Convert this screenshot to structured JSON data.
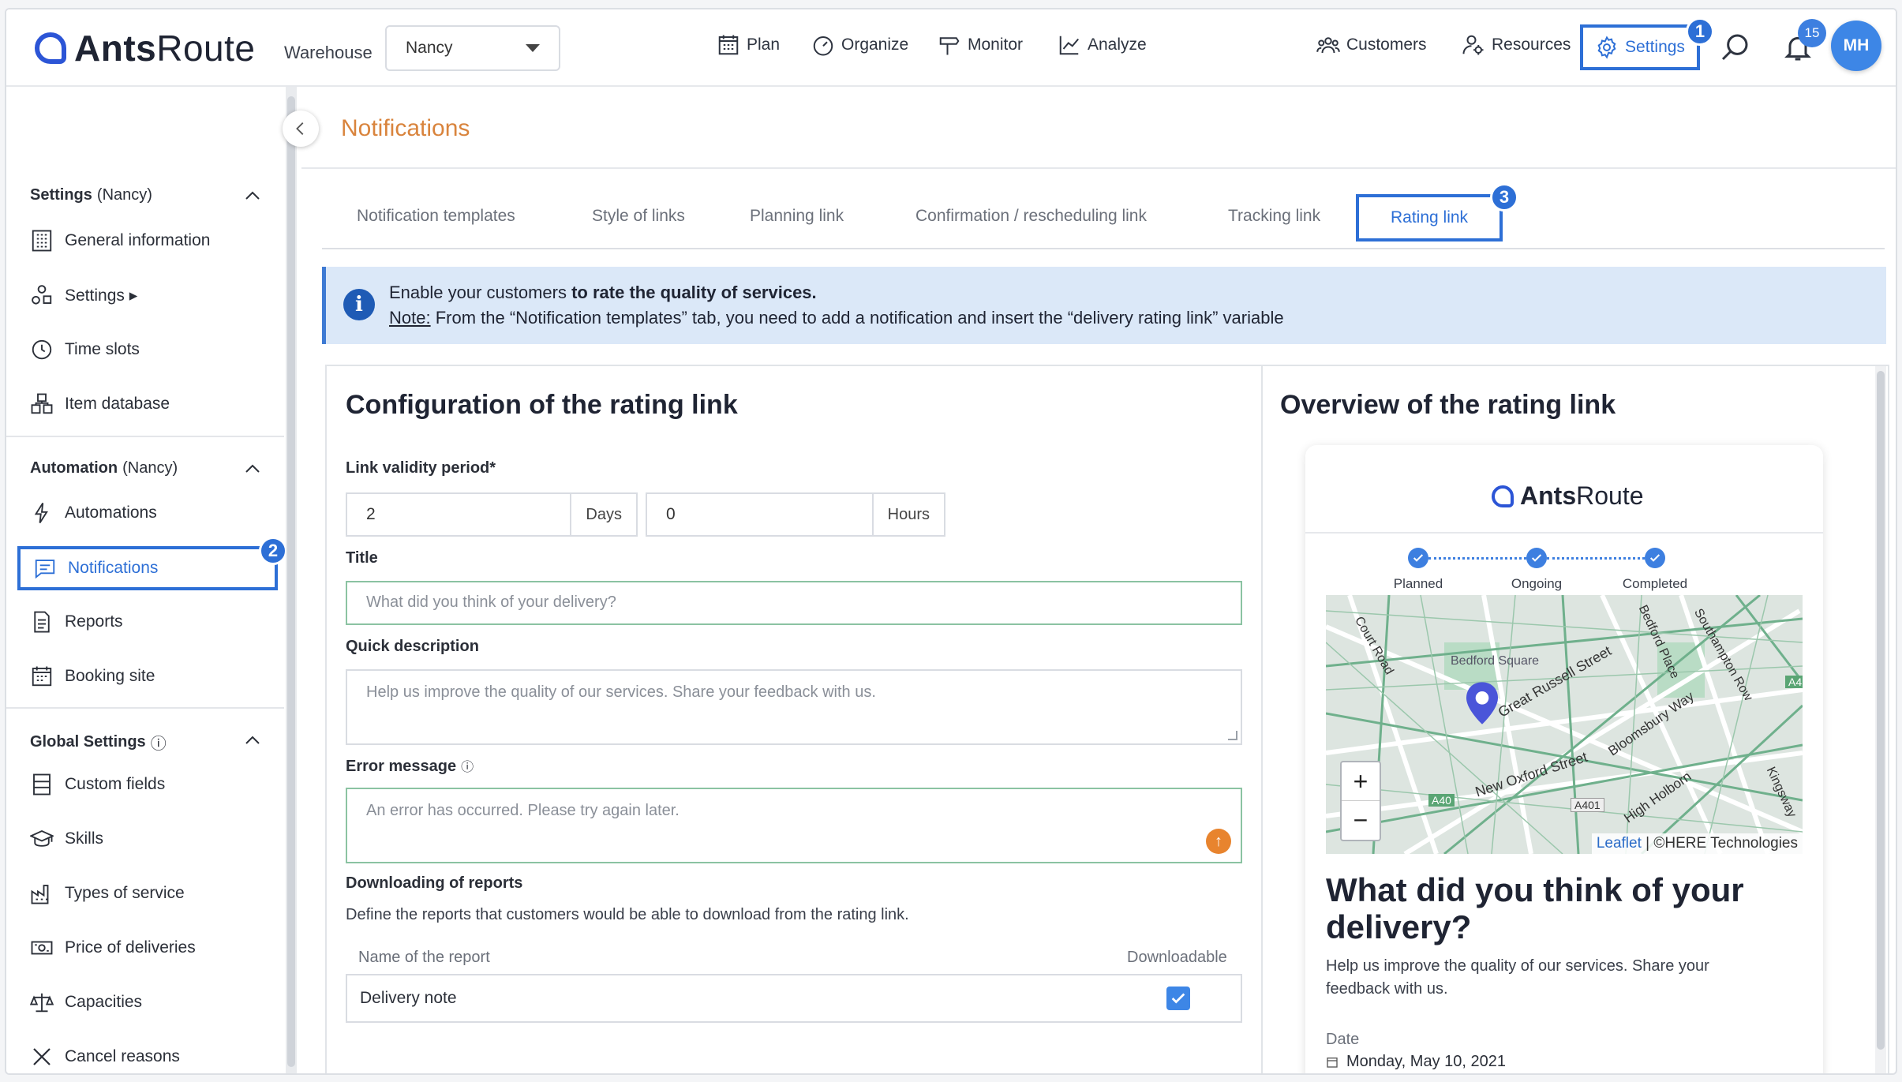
{
  "app": {
    "logo_bold": "Ants",
    "logo_rest": "Route"
  },
  "header": {
    "warehouse_label": "Warehouse",
    "warehouse_value": "Nancy",
    "nav": [
      "Plan",
      "Organize",
      "Monitor",
      "Analyze"
    ],
    "right_nav": [
      "Customers",
      "Resources"
    ],
    "settings_label": "Settings",
    "notification_count": "15",
    "avatar_initials": "MH"
  },
  "annotations": [
    "1",
    "2",
    "3"
  ],
  "sidebar": {
    "sections": [
      {
        "title": "Settings",
        "suffix": "(Nancy)"
      },
      {
        "title": "Automation",
        "suffix": "(Nancy)"
      },
      {
        "title": "Global Settings",
        "suffix": "ⓘ"
      }
    ],
    "items": [
      {
        "label": "General information",
        "icon": "building-icon"
      },
      {
        "label": "Settings ▸",
        "icon": "settings-shapes-icon"
      },
      {
        "label": "Time slots",
        "icon": "clock-icon"
      },
      {
        "label": "Item database",
        "icon": "boxes-icon"
      },
      {
        "label": "Automations",
        "icon": "bolt-icon"
      },
      {
        "label": "Notifications",
        "icon": "chat-icon"
      },
      {
        "label": "Reports",
        "icon": "document-icon"
      },
      {
        "label": "Booking site",
        "icon": "calendar-icon"
      },
      {
        "label": "Custom fields",
        "icon": "list-icon"
      },
      {
        "label": "Skills",
        "icon": "graduation-cap-icon"
      },
      {
        "label": "Types of service",
        "icon": "factory-icon"
      },
      {
        "label": "Price of deliveries",
        "icon": "banknote-icon"
      },
      {
        "label": "Capacities",
        "icon": "scale-icon"
      },
      {
        "label": "Cancel reasons",
        "icon": "x-icon"
      }
    ]
  },
  "page": {
    "title": "Notifications",
    "tabs": [
      "Notification templates",
      "Style of links",
      "Planning link",
      "Confirmation / rescheduling link",
      "Tracking link",
      "Rating link"
    ],
    "info": {
      "line1_prefix": "Enable your customers ",
      "line1_bold": "to rate the quality of services.",
      "note_label": "Note:",
      "line2": " From the “Notification templates” tab, you need to add a notification and insert the “delivery rating link” variable"
    }
  },
  "config": {
    "heading": "Configuration of the rating link",
    "validity_label": "Link validity period*",
    "days_value": "2",
    "days_unit": "Days",
    "hours_value": "0",
    "hours_unit": "Hours",
    "title_label": "Title",
    "title_placeholder": "What did you think of your delivery?",
    "quick_desc_label": "Quick description",
    "quick_desc_placeholder": "Help us improve the quality of our services. Share your feedback with us.",
    "error_label": "Error message",
    "error_placeholder": "An error has occurred. Please try again later.",
    "reports_label": "Downloading of reports",
    "reports_desc": "Define the reports that customers would be able to download from the rating link.",
    "col_name": "Name of the report",
    "col_download": "Downloadable",
    "report_row": "Delivery note"
  },
  "overview": {
    "heading": "Overview of the rating link",
    "steps": [
      "Planned",
      "Ongoing",
      "Completed"
    ],
    "map": {
      "places": [
        "Bedford Square",
        "Great Russell Street",
        "New Oxford Street",
        "Bloomsbury Way",
        "High Holborn",
        "Kingsway",
        "Southampton Row",
        "Bedford Place",
        "Court Road",
        "A40",
        "A401",
        "A4"
      ],
      "attr_leaflet": "Leaflet",
      "attr_rest": " | ©HERE Technologies"
    },
    "card_title": "What did you think of your delivery?",
    "card_desc": "Help us improve the quality of our services. Share your feedback with us.",
    "date_label": "Date",
    "date_value": "Monday, May 10, 2021"
  },
  "colors": {
    "accent": "#2d6fd6",
    "title_orange": "#d9843d",
    "info_bg": "#dbe8f8"
  }
}
